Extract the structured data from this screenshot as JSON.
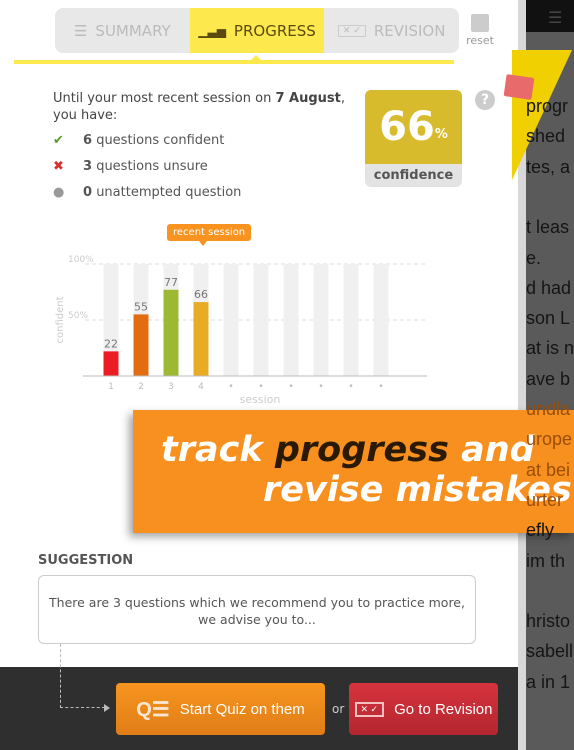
{
  "tabs": [
    {
      "label": "SUMMARY",
      "icon": "list-icon"
    },
    {
      "label": "PROGRESS",
      "icon": "bar-chart-icon",
      "active": true
    },
    {
      "label": "REVISION",
      "icon": "revision-icon"
    }
  ],
  "reset_label": "reset",
  "intro": {
    "prefix": "Until your most recent session on ",
    "date": "7 August",
    "suffix": ", you have:"
  },
  "stats": [
    {
      "count": "6",
      "label": "questions confident",
      "icon": "check-icon",
      "color": "#5a9a2a"
    },
    {
      "count": "3",
      "label": "questions unsure",
      "icon": "cross-icon",
      "color": "#d63030"
    },
    {
      "count": "0",
      "label": "unattempted question",
      "icon": "dot-icon",
      "color": "#999"
    }
  ],
  "confidence": {
    "value": "66",
    "unit": "%",
    "label": "confidence"
  },
  "help": "?",
  "chart_data": {
    "type": "bar",
    "ylabel": "confident",
    "xlabel": "session",
    "ylim": [
      0,
      100
    ],
    "yticks": [
      "100%",
      "50%"
    ],
    "categories": [
      "1",
      "2",
      "3",
      "4",
      "•",
      "•",
      "•",
      "•",
      "•",
      "•"
    ],
    "values": [
      22,
      55,
      77,
      66,
      null,
      null,
      null,
      null,
      null,
      null
    ],
    "colors": [
      "#ec1c24",
      "#e36c10",
      "#9db832",
      "#e8ac24"
    ],
    "annotation": "recent session"
  },
  "banner": {
    "w1": "track ",
    "w2": "progress",
    "w3": " and",
    "line2": "revise mistakes"
  },
  "suggestion": {
    "heading": "SUGGESTION",
    "text": "There are 3 questions which we recommend you to practice more, we advise you to..."
  },
  "buttons": {
    "quiz": "Start Quiz on them",
    "or": "or",
    "revision": "Go to Revision"
  },
  "background_text": [
    "progr",
    "shed",
    "tes, a",
    "",
    "t leas",
    "e.",
    "d had",
    "son L",
    "at is n",
    "ave b",
    "undla",
    "urope",
    "at bei",
    "urter",
    "efly",
    "im th",
    "",
    "hristo",
    "sabell",
    "a in 1"
  ]
}
